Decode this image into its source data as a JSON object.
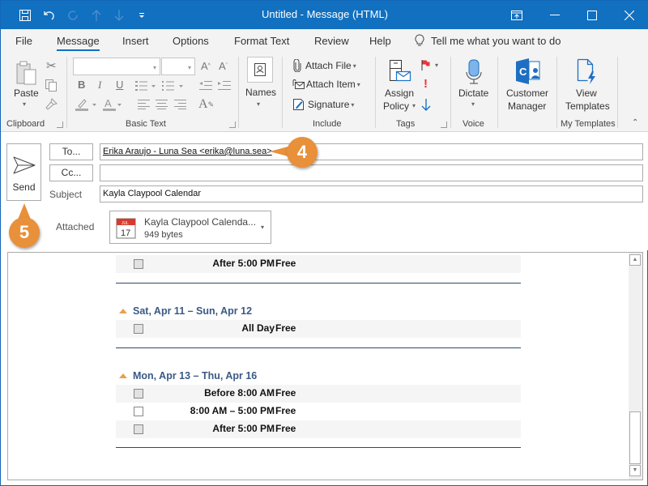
{
  "window": {
    "title": "Untitled  -  Message (HTML)"
  },
  "quick_access": [
    "save-icon",
    "undo-icon",
    "redo-icon",
    "up-icon",
    "down-icon",
    "customize-icon"
  ],
  "tabs": [
    {
      "label": "File"
    },
    {
      "label": "Message",
      "active": true
    },
    {
      "label": "Insert"
    },
    {
      "label": "Options"
    },
    {
      "label": "Format Text"
    },
    {
      "label": "Review"
    },
    {
      "label": "Help"
    }
  ],
  "tell_me": "Tell me what you want to do",
  "ribbon": {
    "clipboard": {
      "label": "Clipboard",
      "paste": "Paste"
    },
    "basic_text": {
      "label": "Basic Text",
      "bold": "B",
      "italic": "I",
      "underline": "U"
    },
    "names": {
      "label": "Names"
    },
    "include": {
      "label": "Include",
      "attach_file": "Attach File",
      "attach_item": "Attach Item",
      "signature": "Signature"
    },
    "tags": {
      "label": "Tags",
      "assign_policy_1": "Assign",
      "assign_policy_2": "Policy"
    },
    "voice": {
      "label": "Voice",
      "dictate": "Dictate"
    },
    "customer_manager": {
      "line1": "Customer",
      "line2": "Manager"
    },
    "my_templates": {
      "label": "My Templates",
      "line1": "View",
      "line2": "Templates"
    }
  },
  "compose": {
    "send": "Send",
    "to_button": "To...",
    "cc_button": "Cc...",
    "to_value": "Erika Araujo - Luna Sea <erika@luna.sea>",
    "cc_value": "",
    "subject_label": "Subject",
    "subject_value": "Kayla Claypool Calendar",
    "attached_label": "Attached",
    "attachment": {
      "name": "Kayla Claypool Calenda...",
      "size": "949 bytes",
      "icon_month": "JUL",
      "icon_day": "17"
    }
  },
  "callouts": {
    "four": "4",
    "five": "5"
  },
  "colors": {
    "accent": "#1170c0",
    "callout": "#e8903a",
    "section_title": "#3a5a86"
  },
  "calendar": {
    "top_row": {
      "time": "After 5:00 PM",
      "status": "Free"
    },
    "sections": [
      {
        "title": "Sat, Apr 11 – Sun, Apr 12",
        "rows": [
          {
            "time": "All Day",
            "status": "Free"
          }
        ]
      },
      {
        "title": "Mon, Apr 13 – Thu, Apr 16",
        "rows": [
          {
            "time": "Before 8:00 AM",
            "status": "Free"
          },
          {
            "time": "8:00 AM – 5:00 PM",
            "status": "Free"
          },
          {
            "time": "After 5:00 PM",
            "status": "Free"
          }
        ]
      }
    ]
  }
}
